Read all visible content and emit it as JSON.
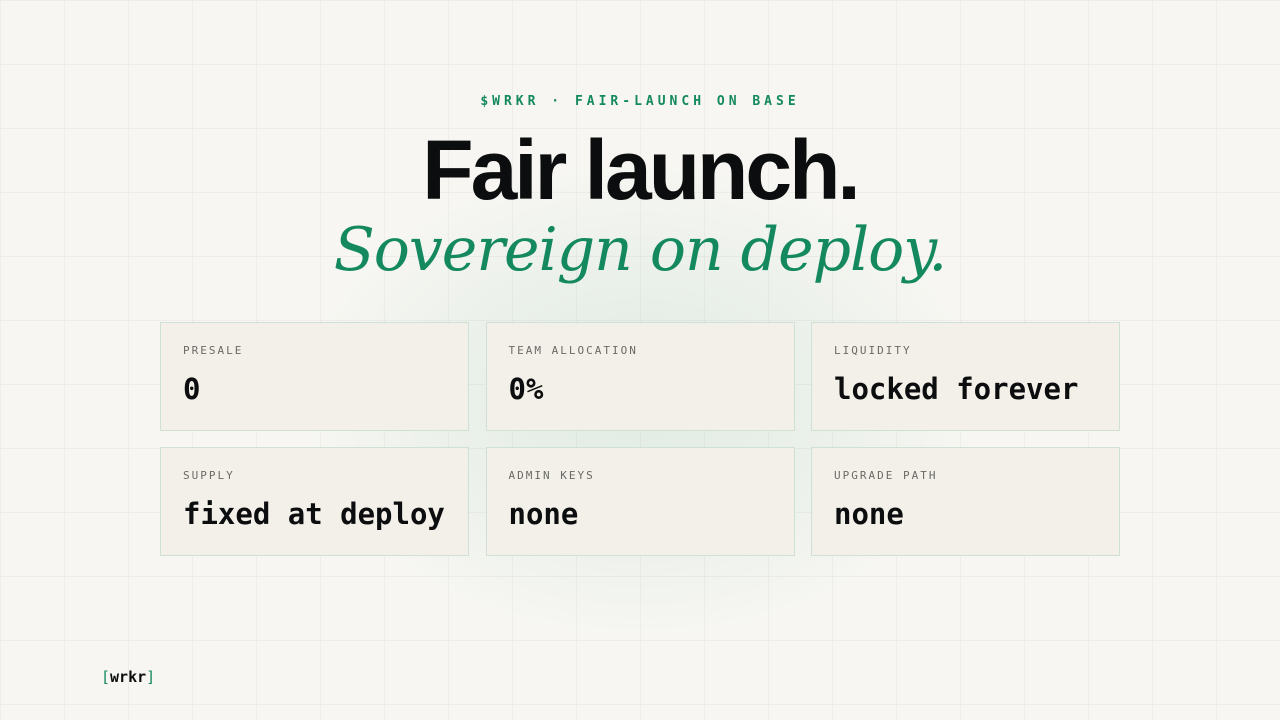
{
  "eyebrow": "$WRKR · FAIR-LAUNCH ON BASE",
  "headline": "Fair launch.",
  "subline": "Sovereign on deploy.",
  "cards": [
    {
      "label": "PRESALE",
      "value": "0"
    },
    {
      "label": "TEAM ALLOCATION",
      "value": "0%"
    },
    {
      "label": "LIQUIDITY",
      "value": "locked forever"
    },
    {
      "label": "SUPPLY",
      "value": "fixed at deploy"
    },
    {
      "label": "ADMIN KEYS",
      "value": "none"
    },
    {
      "label": "UPGRADE PATH",
      "value": "none"
    }
  ],
  "logo": {
    "open": "[",
    "name": "wrkr",
    "close": "]"
  },
  "colors": {
    "accent": "#14895f",
    "background": "#f7f6f2",
    "card": "#f3efe9",
    "card_border": "#cfe0d4",
    "text": "#0c0d0e"
  }
}
